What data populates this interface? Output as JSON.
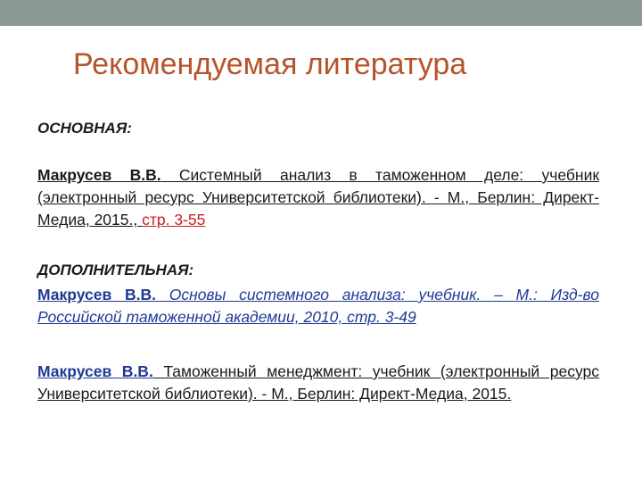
{
  "title": "Рекомендуемая литература",
  "main": {
    "heading": "ОСНОВНАЯ:",
    "ref1": {
      "author": "Макрусев В.В.",
      "text": " Системный анализ в таможенном деле: учебник (электронный ресурс Университетской библиотеки). - М., Берлин: Директ-Медиа, 2015., ",
      "pages": "стр. 3-55"
    }
  },
  "additional": {
    "heading": "ДОПОЛНИТЕЛЬНАЯ:",
    "ref2": {
      "author": "Макрусев В.В.",
      "text": " Основы системного анализа: учебник. – М.: Изд-во Российской таможенной академии, 2010, стр. 3-49"
    },
    "ref3": {
      "author": "Макрусев В.В.",
      "text": " Таможенный менеджмент: учебник (электронный ресурс Университетской библиотеки). - М., Берлин: Директ-Медиа, 2015."
    }
  }
}
